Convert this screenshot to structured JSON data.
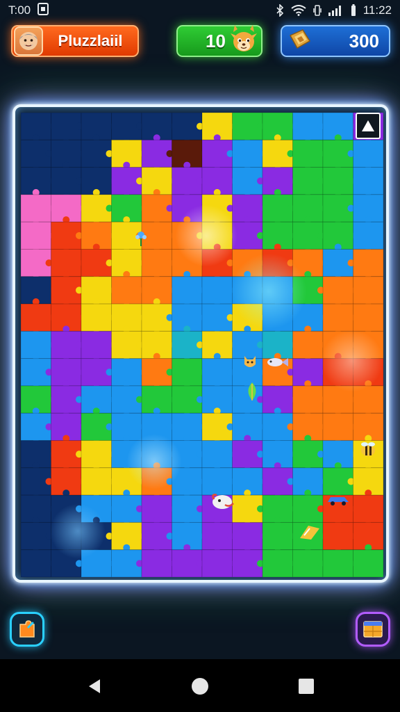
{
  "status_bar": {
    "time": "T:00",
    "clock": "11:22"
  },
  "header": {
    "player_name": "Pluzzlaiil",
    "score": "10",
    "coins": "300"
  },
  "board": {
    "palette": {
      "N": "#0d2f6b",
      "P": "#8a2be2",
      "Y": "#f5d80f",
      "G": "#22c83a",
      "B": "#1d96ef",
      "O": "#ff7a12",
      "R": "#f03a12",
      "K": "#f46ac6",
      "T": "#1bb3c8",
      "D": "#5a1a0a"
    },
    "rows": [
      "NNNNNNYGGBBP",
      "NNNYPDPBYGGB",
      "NNNPYPPBPGGB",
      "KKYGOPYPGGGB",
      "KROYOOYPGGGB",
      "KRRYOOROROBO",
      "NRYOOBBBBGOO",
      "RRYYYBBYBBOO",
      "BPPYYTYBTOOO",
      "BPPBOGBBOPRR",
      "GPBBGGBBPOOO",
      "BPGBBBYBBOOO",
      "NRYBBBBPBGBY",
      "NRYYOBBBPBGY",
      "NNBBPBPYGGRR",
      "NNNYPBPPGGRR",
      "NNBBPPPPGGGG"
    ]
  }
}
